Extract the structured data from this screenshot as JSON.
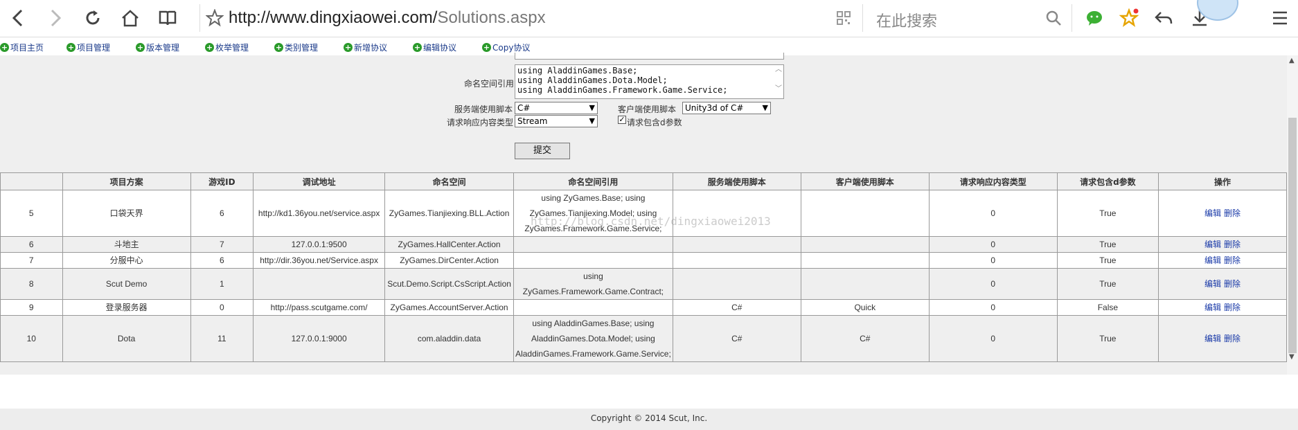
{
  "browser": {
    "url_host": "http://www.dingxiaowei.com/",
    "url_path": "Solutions.aspx",
    "search_placeholder": "在此搜索"
  },
  "menu": [
    {
      "label": "项目主页"
    },
    {
      "label": "项目管理"
    },
    {
      "label": "版本管理"
    },
    {
      "label": "枚举管理"
    },
    {
      "label": "类别管理"
    },
    {
      "label": "新增协议"
    },
    {
      "label": "编辑协议"
    },
    {
      "label": "Copy协议"
    }
  ],
  "form": {
    "namespace_ref_label": "命名空间引用",
    "namespace_ref_lines": [
      "using AladdinGames.Base;",
      "using AladdinGames.Dota.Model;",
      "using AladdinGames.Framework.Game.Service;"
    ],
    "server_script_label": "服务端使用脚本",
    "server_script_value": "C#",
    "client_script_label": "客户端使用脚本",
    "client_script_value": "Unity3d of C#",
    "response_type_label": "请求响应内容类型",
    "response_type_value": "Stream",
    "include_d_label": "请求包含d参数",
    "include_d_checked": true,
    "submit_label": "提交"
  },
  "table": {
    "headers": [
      "",
      "项目方案",
      "游戏ID",
      "调试地址",
      "命名空间",
      "命名空间引用",
      "服务端使用脚本",
      "客户端使用脚本",
      "请求响应内容类型",
      "请求包含d参数",
      "操作"
    ],
    "edit_label": "编辑",
    "delete_label": "删除",
    "rows": [
      {
        "id": "5",
        "name": "口袋天界",
        "game_id": "6",
        "debug_url": "http://kd1.36you.net/service.aspx",
        "namespace": "ZyGames.Tianjiexing.BLL.Action",
        "ns_ref": [
          "using ZyGames.Base; using",
          "ZyGames.Tianjiexing.Model; using",
          "ZyGames.Framework.Game.Service;"
        ],
        "server_script": "",
        "client_script": "",
        "response_type": "0",
        "include_d": "True"
      },
      {
        "id": "6",
        "name": "斗地主",
        "game_id": "7",
        "debug_url": "127.0.0.1:9500",
        "namespace": "ZyGames.HallCenter.Action",
        "ns_ref": [],
        "server_script": "",
        "client_script": "",
        "response_type": "0",
        "include_d": "True"
      },
      {
        "id": "7",
        "name": "分服中心",
        "game_id": "6",
        "debug_url": "http://dir.36you.net/Service.aspx",
        "namespace": "ZyGames.DirCenter.Action",
        "ns_ref": [],
        "server_script": "",
        "client_script": "",
        "response_type": "0",
        "include_d": "True"
      },
      {
        "id": "8",
        "name": "Scut Demo",
        "game_id": "1",
        "debug_url": "",
        "namespace": "Scut.Demo.Script.CsScript.Action",
        "ns_ref": [
          "using",
          "ZyGames.Framework.Game.Contract;"
        ],
        "server_script": "",
        "client_script": "",
        "response_type": "0",
        "include_d": "True"
      },
      {
        "id": "9",
        "name": "登录服务器",
        "game_id": "0",
        "debug_url": "http://pass.scutgame.com/",
        "namespace": "ZyGames.AccountServer.Action",
        "ns_ref": [],
        "server_script": "C#",
        "client_script": "Quick",
        "response_type": "0",
        "include_d": "False"
      },
      {
        "id": "10",
        "name": "Dota",
        "game_id": "11",
        "debug_url": "127.0.0.1:9000",
        "namespace": "com.aladdin.data",
        "ns_ref": [
          "using AladdinGames.Base; using",
          "AladdinGames.Dota.Model; using",
          "AladdinGames.Framework.Game.Service;"
        ],
        "server_script": "C#",
        "client_script": "C#",
        "response_type": "0",
        "include_d": "True"
      }
    ]
  },
  "watermark": "http://blog.csdn.net/dingxiaowei2013",
  "footer": "Copyright © 2014 Scut, Inc."
}
